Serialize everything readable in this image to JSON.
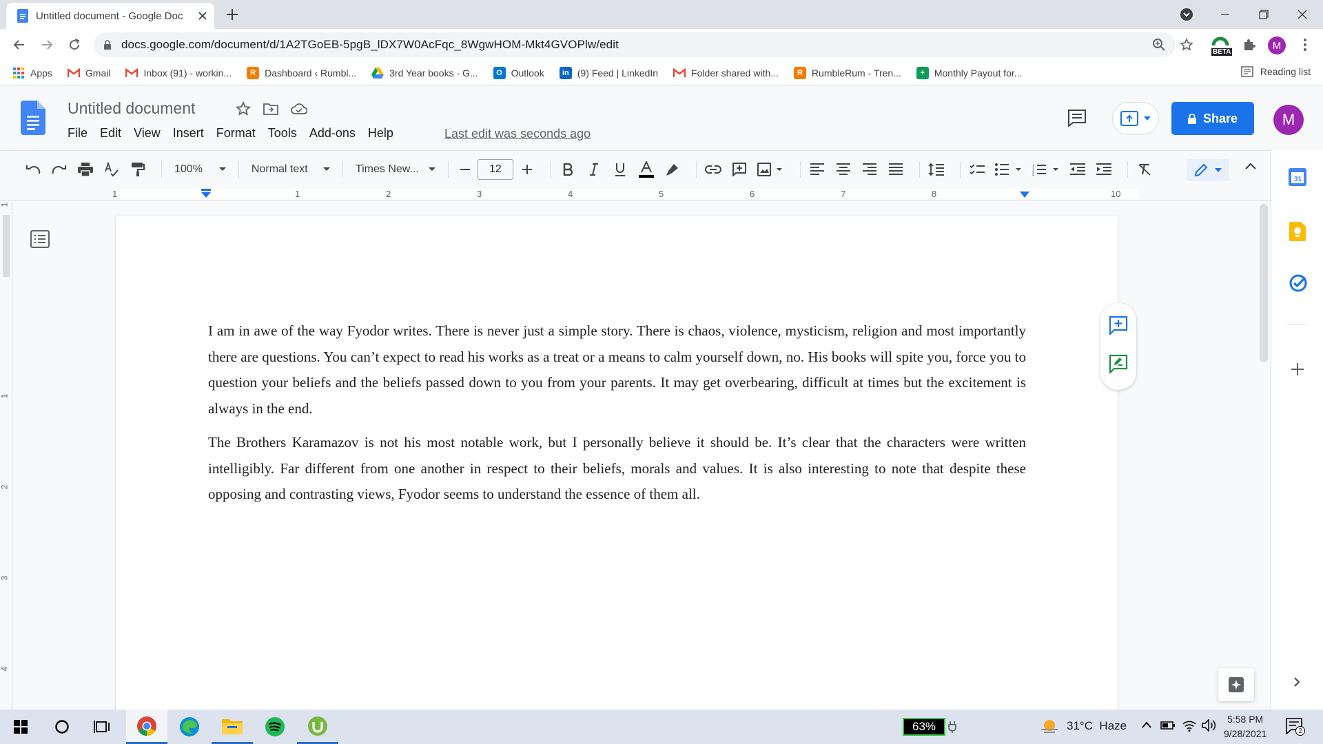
{
  "browser": {
    "tab_title": "Untitled document - Google Doc",
    "url": "docs.google.com/document/d/1A2TGoEB-5pgB_lDX7W0AcFqc_8WgwHOM-Mkt4GVOPlw/edit",
    "profile_initial": "M",
    "extension_badge": "BETA"
  },
  "bookmarks": [
    {
      "label": "Apps",
      "icon": "apps-grid-icon",
      "color": "#4285f4"
    },
    {
      "label": "Gmail",
      "icon": "gmail-icon",
      "color": "#ea4335"
    },
    {
      "label": "Inbox (91) - workin...",
      "icon": "gmail-icon",
      "color": "#ea4335"
    },
    {
      "label": "Dashboard ‹ Rumbl...",
      "icon": "rumble-icon",
      "color": "#f57c00"
    },
    {
      "label": "3rd Year books - G...",
      "icon": "drive-icon",
      "color": "#0f9d58"
    },
    {
      "label": "Outlook",
      "icon": "outlook-icon",
      "color": "#0078d4"
    },
    {
      "label": "(9) Feed | LinkedIn",
      "icon": "linkedin-icon",
      "color": "#0a66c2"
    },
    {
      "label": "Folder shared with...",
      "icon": "gmail-icon",
      "color": "#ea4335"
    },
    {
      "label": "RumbleRum - Tren...",
      "icon": "rumble-icon",
      "color": "#f57c00"
    },
    {
      "label": "Monthly Payout for...",
      "icon": "sheets-icon",
      "color": "#0f9d58"
    }
  ],
  "reading_list": "Reading list",
  "docs": {
    "title": "Untitled document",
    "menu": [
      "File",
      "Edit",
      "View",
      "Insert",
      "Format",
      "Tools",
      "Add-ons",
      "Help"
    ],
    "last_edit": "Last edit was seconds ago",
    "share_label": "Share",
    "avatar_initial": "M"
  },
  "format_toolbar": {
    "zoom": "100%",
    "style": "Normal text",
    "font": "Times New...",
    "font_size": "12"
  },
  "ruler": {
    "labels": [
      "1",
      "1",
      "2",
      "3",
      "4",
      "5",
      "6",
      "7",
      "8",
      "10"
    ],
    "vertical_labels": [
      "1",
      "1",
      "2",
      "3",
      "4"
    ]
  },
  "document": {
    "paragraphs": [
      "I am in awe of the way Fyodor writes. There is never just a simple story. There is chaos, violence, mysticism, religion and most importantly there are questions. You can’t expect to read his works as a treat or a means to calm yourself down, no. His books will spite you, force you to question your beliefs and the beliefs passed down to you from your parents. It may get overbearing, difficult at times but the excitement is always in the end.",
      "The Brothers Karamazov is not his most notable work, but I personally believe it should be. It’s clear that the characters were written intelligibly. Far different from one another in respect to their beliefs, morals and values. It is also interesting to note that despite these opposing and contrasting views, Fyodor seems to understand the essence of them all."
    ]
  },
  "taskbar": {
    "battery": "63%",
    "weather": "31°C  Haze",
    "time": "5:58 PM",
    "date": "9/28/2021",
    "notification_count": "2"
  },
  "colors": {
    "docs_blue": "#1a73e8",
    "avatar_purple": "#9c27b0",
    "battery_green": "#35c13d"
  }
}
